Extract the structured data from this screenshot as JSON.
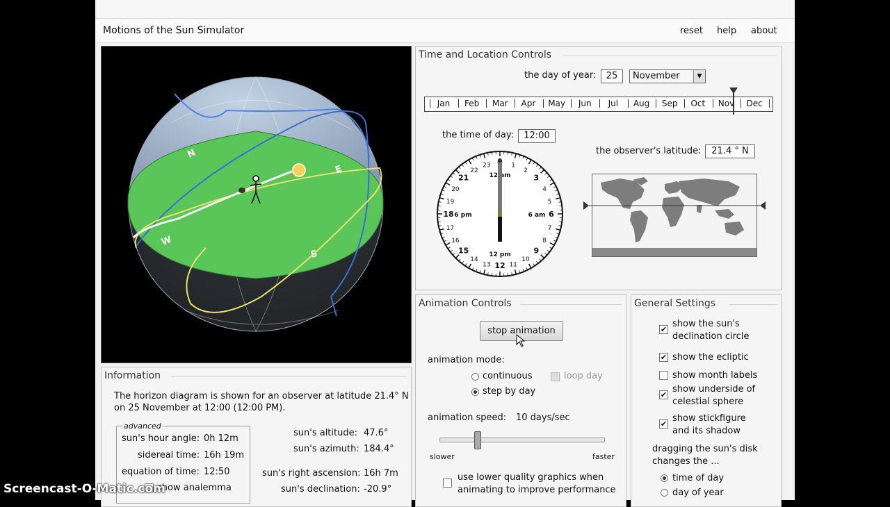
{
  "header": {
    "title": "Motions of the Sun Simulator",
    "links": [
      "reset",
      "help",
      "about"
    ]
  },
  "sphere": {
    "directions": [
      "N",
      "E",
      "S",
      "W"
    ],
    "colors": {
      "horizon": "#52c052",
      "ecliptic": "#e8e26a",
      "declination": "#3a78d8",
      "path": "#f4f4f4",
      "sky": "#9fb3cc"
    }
  },
  "time_location": {
    "title": "Time and Location Controls",
    "day_label": "the day of year:",
    "day_value": "25",
    "month_value": "November",
    "months": [
      "Jan",
      "Feb",
      "Mar",
      "Apr",
      "May",
      "Jun",
      "Jul",
      "Aug",
      "Sep",
      "Oct",
      "Nov",
      "Dec"
    ],
    "time_label": "the time of day:",
    "time_value": "12:00",
    "latitude_label": "the observer's latitude:",
    "latitude_value": "21.4 ° N",
    "latitude_fraction": 0.38
  },
  "clock": {
    "hours": [
      "1",
      "2",
      "3",
      "4",
      "5",
      "6",
      "7",
      "8",
      "9",
      "10",
      "11",
      "12",
      "13",
      "14",
      "15",
      "16",
      "17",
      "18",
      "19",
      "20",
      "21",
      "22",
      "23",
      "0"
    ],
    "labels": {
      "top": "12 am",
      "bottom": "12 pm",
      "left": "6 pm",
      "right": "6 am"
    },
    "hour": 12
  },
  "information": {
    "title": "Information",
    "line1": "The horizon diagram is shown for an observer at latitude 21.4° N",
    "line2": "on 25 November at 12:00 (12:00 PM).",
    "advanced_title": "advanced",
    "hour_angle_label": "sun's hour angle:",
    "hour_angle_value": "0h 12m",
    "sidereal_label": "sidereal time:",
    "sidereal_value": "16h 19m",
    "eot_label": "equation of time:",
    "eot_value": "12:50",
    "analemma_label": "show analemma",
    "altitude_label": "sun's altitude:",
    "altitude_value": "47.6°",
    "azimuth_label": "sun's azimuth:",
    "azimuth_value": "184.4°",
    "ra_label": "sun's right ascension:",
    "ra_value": "16h 7m",
    "dec_label": "sun's declination:",
    "dec_value": "-20.9°"
  },
  "animation": {
    "title": "Animation Controls",
    "stop_button": "stop animation",
    "mode_label": "animation mode:",
    "continuous_label": "continuous",
    "loop_day_label": "loop day",
    "step_by_day_label": "step by day",
    "speed_label": "animation speed:",
    "speed_value": "10 days/sec",
    "slower_label": "slower",
    "faster_label": "faster",
    "speed_fraction": 0.23,
    "low_quality_line1": "use lower quality graphics when",
    "low_quality_line2": "animating to improve performance"
  },
  "general": {
    "title": "General Settings",
    "options": [
      {
        "line1": "show the sun's",
        "line2": "declination circle",
        "checked": true
      },
      {
        "line1": "show the ecliptic",
        "line2": "",
        "checked": true
      },
      {
        "line1": "show month labels",
        "line2": "",
        "checked": false
      },
      {
        "line1": "show underside of",
        "line2": "celestial sphere",
        "checked": true
      },
      {
        "line1": "show stickfigure",
        "line2": "and its shadow",
        "checked": true
      }
    ],
    "drag_line1": "dragging the sun's disk",
    "drag_line2": "changes the ...",
    "radio1": "time of day",
    "radio2": "day of year"
  },
  "watermark": "Screencast-O-Matic.com"
}
